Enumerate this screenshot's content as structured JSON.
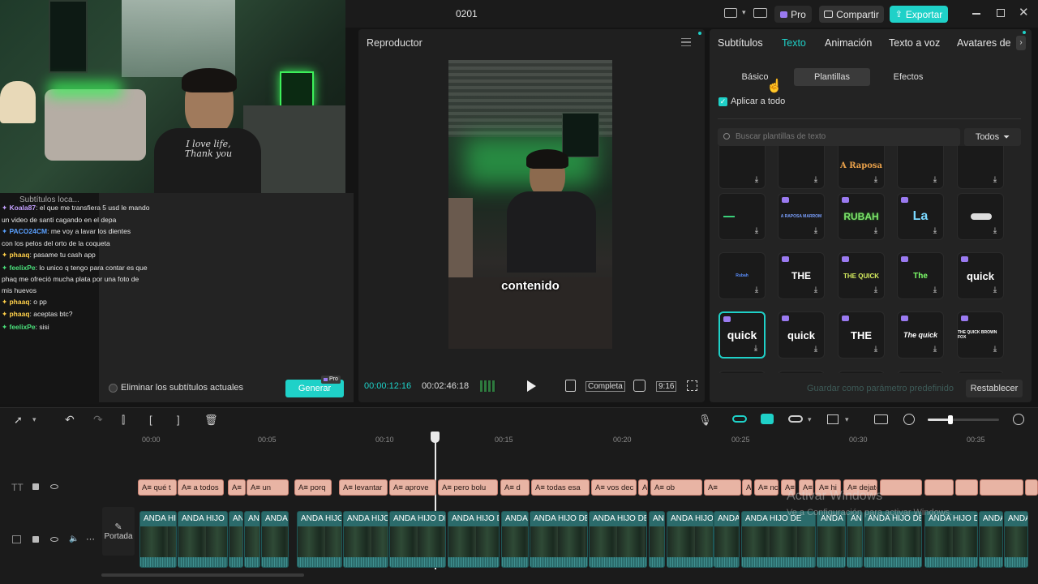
{
  "app": {
    "project_title": "0201",
    "pro_label": "Pro",
    "share_label": "Compartir",
    "export_label": "Exportar"
  },
  "colors": {
    "accent": "#1fd1c8",
    "pro_purple": "#9a7af0",
    "clip_text": "#e8b4a4",
    "clip_video": "#2b6b6b"
  },
  "webcam": {
    "shirt_text_1": "I love life,",
    "shirt_text_2": "Thank you"
  },
  "chat": {
    "header": "Subtítulos loca...",
    "messages": [
      {
        "user": "Koala87",
        "text": ": el que me transfiera 5 usd le mando",
        "color": "#c4a0ff"
      },
      {
        "user": "",
        "text": "un video de santi cagando en el depa",
        "color": "#c4a0ff"
      },
      {
        "user": "PACO24CM",
        "text": ": me voy a lavar los dientes",
        "color": "#5aa0ff"
      },
      {
        "user": "",
        "text": "con los pelos del orto de la coqueta",
        "color": "#5aa0ff"
      },
      {
        "user": "phaaq",
        "text": ": pasame tu cash app",
        "color": "#ffd04a"
      },
      {
        "user": "feelixPe",
        "text": ": lo unico q tengo para contar es que",
        "color": "#4ae07a"
      },
      {
        "user": "",
        "text": "phaq me ofreció mucha plata por una foto de",
        "color": "#4ae07a"
      },
      {
        "user": "",
        "text": "mis huevos",
        "color": "#4ae07a"
      },
      {
        "user": "phaaq",
        "text": ": o pp",
        "color": "#ffd04a"
      },
      {
        "user": "phaaq",
        "text": ": aceptas btc?",
        "color": "#ffd04a"
      },
      {
        "user": "feelixPe",
        "text": ": sisi",
        "color": "#4ae07a"
      }
    ]
  },
  "left_panel": {
    "remove_subtitles_label": "Eliminar los subtítulos actuales",
    "generate_label": "Generar",
    "generate_badge": "Pro"
  },
  "player": {
    "title": "Reproductor",
    "subtitle_overlay": "contenido",
    "current_time": "00:00:12:16",
    "total_time": "00:02:46:18",
    "full_label": "Completa",
    "ratio_label": "9:16"
  },
  "right_panel": {
    "tabs": [
      "Subtítulos",
      "Texto",
      "Animación",
      "Texto a voz",
      "Avatares de"
    ],
    "active_tab": "Texto",
    "subtabs": [
      "Básico",
      "Plantillas",
      "Efectos"
    ],
    "active_subtab": "Plantillas",
    "apply_all_label": "Aplicar a todo",
    "search_placeholder": "Buscar plantillas de texto",
    "filter_label": "Todos",
    "save_preset_label": "Guardar como parámetro predefinido",
    "reset_label": "Restablecer",
    "template_labels": {
      "r0c2": "A Raposa",
      "r1c1": "A RAPOSA MARROM",
      "r1c2": "RUBAH",
      "r1c3": "La",
      "r2c0": "Rubah",
      "r2c1": "THE",
      "r2c2": "THE QUICK",
      "r2c3": "The",
      "r2c4": "quick",
      "r3c0": "quick",
      "r3c1": "quick",
      "r3c2": "THE",
      "r3c3": "The quick",
      "r3c4": "THE QUICK BROWN FOX"
    }
  },
  "timeline": {
    "ticks": [
      "00:00",
      "00:05",
      "00:10",
      "00:15",
      "00:20",
      "00:25",
      "00:30",
      "00:35"
    ],
    "cover_label": "Portada",
    "text_clips": [
      "A≡ qué t",
      "A≡ a todos",
      "A≡",
      "A≡ un",
      "A≡ porq",
      "A≡ levantar",
      "A≡ aprove",
      "A≡ pero bolu",
      "A≡ d",
      "A≡ todas esa",
      "A≡ vos dec",
      "A≡ pero igu",
      "A≡ ob",
      "A≡",
      "A≡",
      "A≡ nc",
      "A≡",
      "A≡ influe",
      "A≡ hi",
      "A≡ dejate"
    ],
    "video_clip_label": "ANDA HIJO DE",
    "video_clip_short": "ANDA HI",
    "video_clip_an": "AN"
  },
  "watermark": {
    "line1": "Activar Windows",
    "line2": "Ve a Configuración para activar Windows."
  }
}
